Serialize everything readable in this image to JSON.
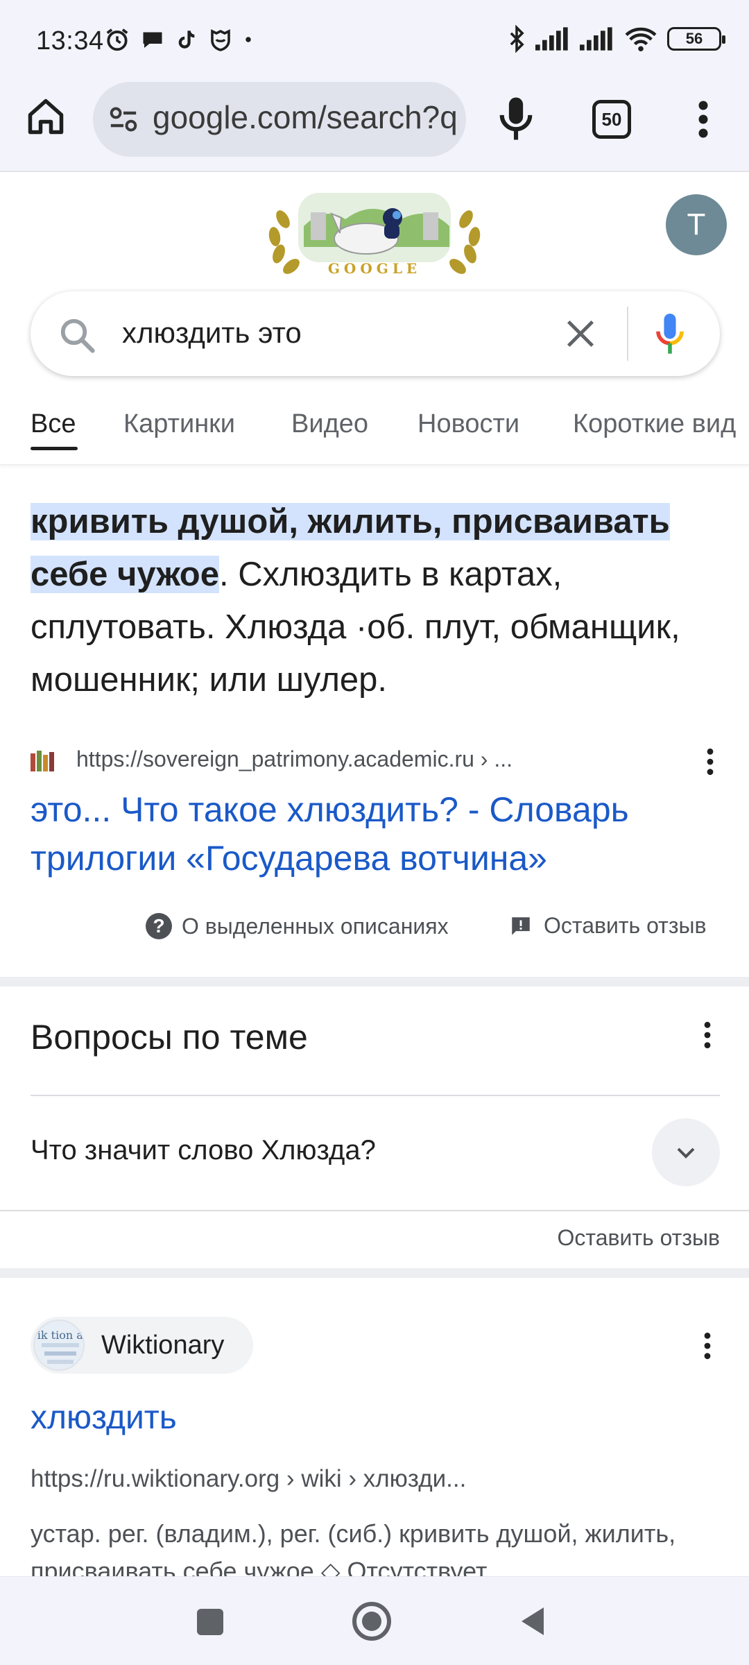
{
  "status_bar": {
    "time": "13:34",
    "battery": "56"
  },
  "browser": {
    "url": "google.com/search?q",
    "tab_count": "50"
  },
  "google": {
    "avatar_letter": "T",
    "doodle_text": "GOOGLE",
    "query": "хлюздить это"
  },
  "tabs": [
    "Все",
    "Картинки",
    "Видео",
    "Новости",
    "Короткие вид"
  ],
  "featured_snippet": {
    "highlight": "кривить душой, жилить, присваивать себе чужое",
    "rest": ". Схлюздить в картах, сплутовать. Хлюзда ·об. плут, обманщик, мошенник; или шулер.",
    "source_url": "https://sovereign_patrimony.academic.ru › ...",
    "title": "это... Что такое хлюздить? - Словарь трилогии «Государева вотчина»",
    "about_label": "О выделенных описаниях",
    "feedback_label": "Оставить отзыв"
  },
  "related_questions": {
    "title": "Вопросы по теме",
    "questions": [
      "Что значит слово Хлюзда?"
    ],
    "feedback_label": "Оставить отзыв"
  },
  "result2": {
    "site_name": "Wiktionary",
    "logo_text": "Wik tion ary",
    "title": "хлюздить",
    "url": "https://ru.wiktionary.org › wiki › хлюзди...",
    "snippet": "устар. рег. (владим.), рег. (сиб.) кривить душой, жилить, присваивать себе чужое ◇ Отсутствует"
  },
  "colors": {
    "link": "#1a59c8",
    "highlight": "#d3e3fd",
    "chrome_bg": "#f3f4fb",
    "avatar": "#6d8a96"
  }
}
